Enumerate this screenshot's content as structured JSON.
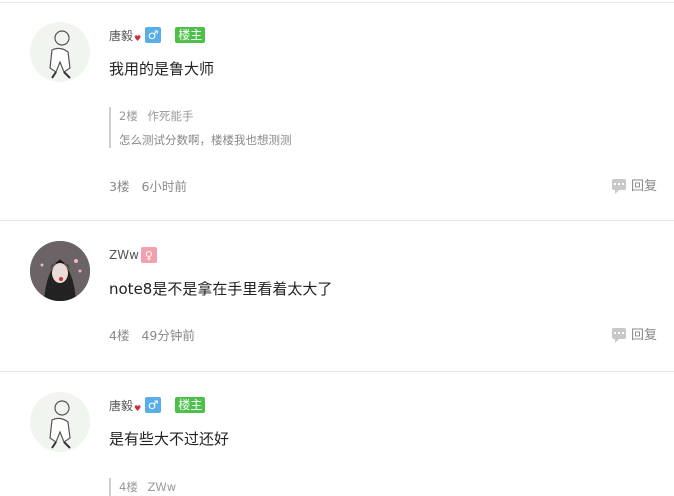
{
  "comments": [
    {
      "username": "唐毅",
      "is_owner": true,
      "owner_label": "楼主",
      "gender": "♂",
      "content": "我用的是鲁大师",
      "quote": {
        "floor": "2楼",
        "user": "作死能手",
        "text": "怎么测试分数啊，楼楼我也想测测"
      },
      "floor": "3楼",
      "time": "6小时前",
      "reply_label": "回复"
    },
    {
      "username": "ZWw",
      "gender": "♀",
      "content": "note8是不是拿在手里看着太大了",
      "floor": "4楼",
      "time": "49分钟前",
      "reply_label": "回复"
    },
    {
      "username": "唐毅",
      "is_owner": true,
      "owner_label": "楼主",
      "gender": "♂",
      "content": "是有些大不过还好",
      "quote": {
        "floor": "4楼",
        "user": "ZWw"
      }
    }
  ],
  "colors": {
    "owner_badge": "#4cc04b",
    "male_badge": "#5aaee8",
    "female_badge": "#f2a0ad"
  }
}
